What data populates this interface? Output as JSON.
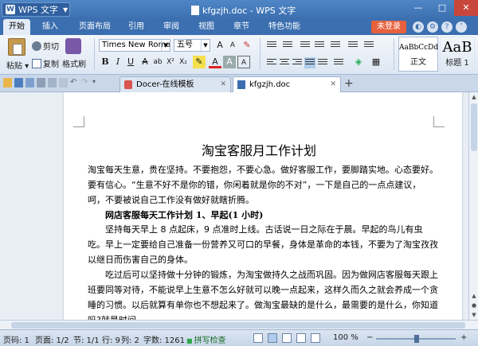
{
  "app": {
    "name": "WPS 文字",
    "window_title": "kfgzjh.doc - WPS 文字"
  },
  "window_controls": {
    "minimize": "—",
    "maximize": "□",
    "close": "✕"
  },
  "menu_tabs": [
    "开始",
    "插入",
    "页面布局",
    "引用",
    "审阅",
    "视图",
    "章节",
    "特色功能"
  ],
  "login_label": "未登录",
  "ribbon": {
    "paste": "粘贴",
    "cut": "剪切",
    "copy": "复制",
    "format_painter": "格式刷",
    "font_family": "Times New Roma",
    "font_size": "五号",
    "styles": [
      {
        "sample": "AaBbCcDd",
        "label": "正文"
      },
      {
        "sample": "AaB",
        "label": "标题 1"
      }
    ]
  },
  "doc_tabs": [
    {
      "label": "Docer-在线模板",
      "active": false
    },
    {
      "label": "kfgzjh.doc",
      "active": true
    }
  ],
  "document": {
    "title": "淘宝客服月工作计划",
    "paragraph1": "淘宝每天生意，贵在坚持。不要抱怨，不要心急。做好客服工作，要脚踏实地。心态要好。要有信心。“生意不好不是你的错，你闲着就是你的不对”，一下是自己的一点点建议，呵，不要被说自己工作没有做好就瞎折腾。",
    "heading1": "网店客服每天工作计划 1、早起(1 小时)",
    "paragraph2": "坚持每天早上 8 点起床，9 点准时上线。古话说一日之际在于晨。早起的鸟儿有虫吃。早上一定要给自己准备一份营养又可口的早餐，身体是革命的本钱，不要为了淘宝孜孜以继日而伤害自己的身体。",
    "paragraph3": "吃过后可以坚持做十分钟的锻炼，为淘宝做持久之战而巩固。因为做网店客服每天跟上班要同等对待，不能说早上生意不怎么好就可以晚一点起来，这样久而久之就会养成一个贪睡的习惯。以后就算有单你也不想起来了。做淘宝最缺的是什么，最需要的是什么，你知道吗?就是时间。"
  },
  "status": {
    "page_number": "页码: 1",
    "pages": "页面: 1/2",
    "section": "节: 1/1",
    "row": "行: 9",
    "column": "列: 2",
    "word_count": "字数: 1261",
    "spell_check": "拼写检查",
    "zoom": "100 %"
  },
  "colors": {
    "titlebar": "#3b6fb0",
    "login": "#e8613c",
    "close": "#c9463d"
  }
}
